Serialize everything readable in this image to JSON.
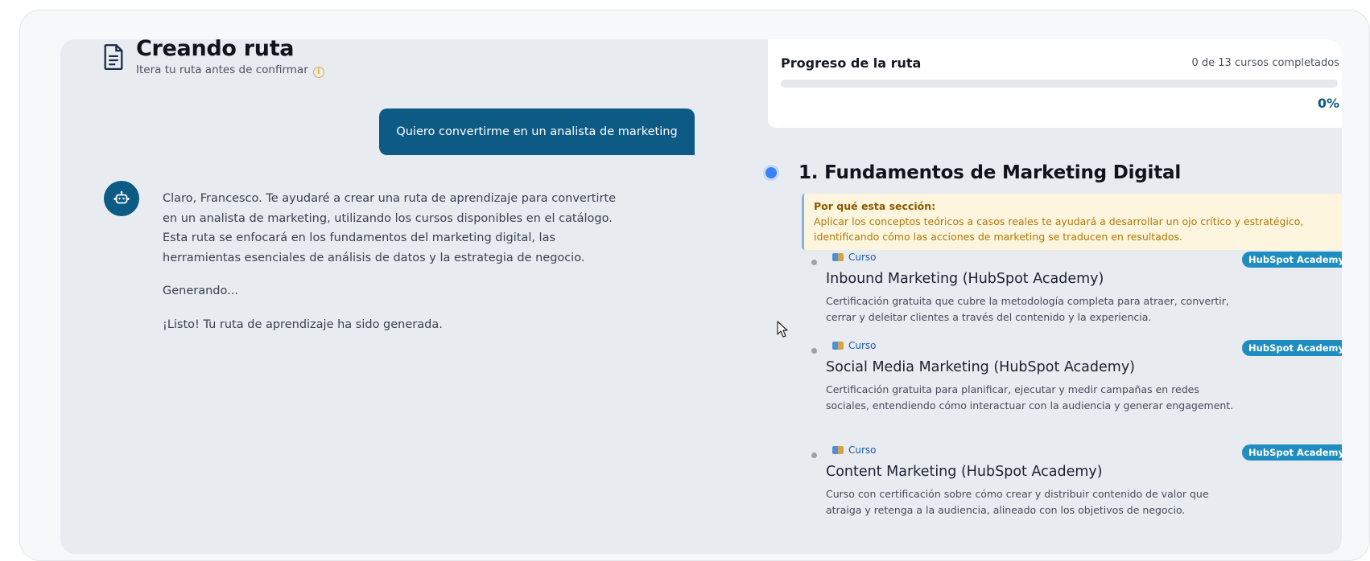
{
  "header": {
    "title": "Creando ruta",
    "subtitle": "Itera tu ruta antes de confirmar",
    "doc_icon": "document-icon",
    "info_icon": "info-icon"
  },
  "chat": {
    "user_message": "Quiero convertirme en un analista de marketing",
    "bot_icon": "robot-icon",
    "bot_messages": [
      "Claro, Francesco. Te ayudaré a crear una ruta de aprendizaje para convertirte en un analista de marketing, utilizando los cursos disponibles en el catálogo. Esta ruta se enfocará en los fundamentos del marketing digital, las herramientas esenciales de análisis de datos y la estrategia de negocio.",
      "Generando...",
      "¡Listo! Tu ruta de aprendizaje ha sido generada."
    ]
  },
  "progress": {
    "title": "Progreso de la ruta",
    "count_text": "0 de 13 cursos completados",
    "percent_text": "0%",
    "fraction": 0
  },
  "section": {
    "title": "1. Fundamentos de Marketing Digital",
    "why_label": "Por qué esta sección:",
    "why_text": "Aplicar los conceptos teóricos a casos reales te ayudará a desarrollar un ojo crítico y estratégico, identificando cómo las acciones de marketing se traducen en resultados."
  },
  "courses": [
    {
      "type": "Curso",
      "badge": "HubSpot Academy",
      "name": "Inbound Marketing (HubSpot Academy)",
      "description": "Certificación gratuita que cubre la metodología completa para atraer, convertir, cerrar y deleitar clientes a través del contenido y la experiencia."
    },
    {
      "type": "Curso",
      "badge": "HubSpot Academy",
      "name": "Social Media Marketing (HubSpot Academy)",
      "description": "Certificación gratuita para planificar, ejecutar y medir campañas en redes sociales, entendiendo cómo interactuar con la audiencia y generar engagement."
    },
    {
      "type": "Curso",
      "badge": "HubSpot Academy",
      "name": "Content Marketing (HubSpot Academy)",
      "description": "Curso con certificación sobre cómo crear y distribuir contenido de valor que atraiga y retenga a la audiencia, alineado con los objetivos de negocio."
    }
  ],
  "colors": {
    "accent": "#0d5a85",
    "badge": "#1f8dbf",
    "warning_bg": "#fdf5dd",
    "section_dot": "#3b82f6"
  }
}
